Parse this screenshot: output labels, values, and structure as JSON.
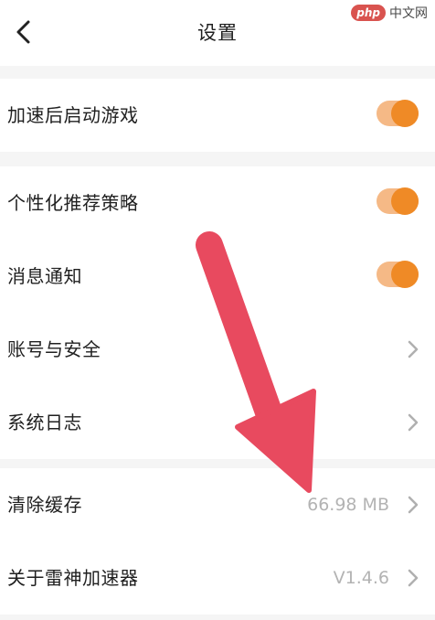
{
  "header": {
    "title": "设置",
    "back_icon": "chevron-left-icon"
  },
  "watermark": {
    "badge": "php",
    "text": "中文网"
  },
  "settings": {
    "launch_game": {
      "label": "加速后启动游戏",
      "enabled": true
    },
    "personalized": {
      "label": "个性化推荐策略",
      "enabled": true
    },
    "notifications": {
      "label": "消息通知",
      "enabled": true
    },
    "account": {
      "label": "账号与安全"
    },
    "logs": {
      "label": "系统日志"
    },
    "cache": {
      "label": "清除缓存",
      "value": "66.98 MB"
    },
    "about": {
      "label": "关于雷神加速器",
      "value": "V1.4.6"
    }
  },
  "colors": {
    "toggle_on": "#ef8a26",
    "toggle_track": "#f5b986",
    "annotation_arrow": "#e84a5f"
  }
}
